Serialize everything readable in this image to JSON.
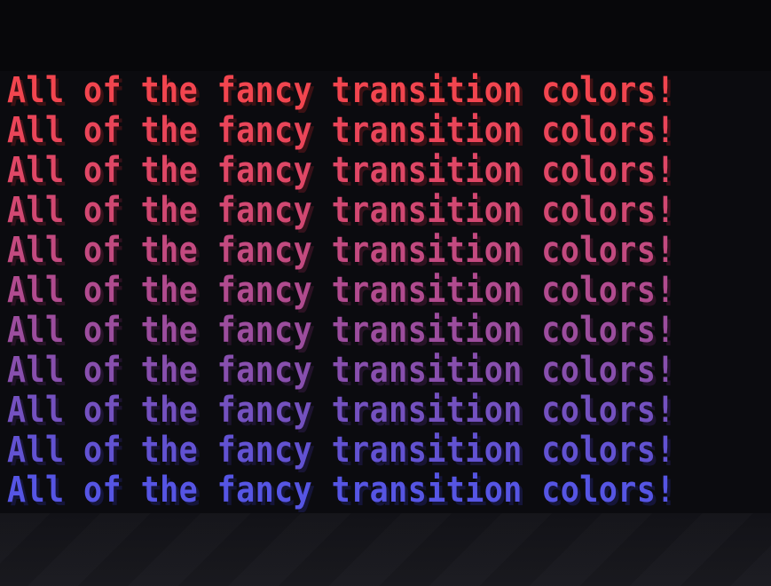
{
  "chat": {
    "lines": [
      {
        "text": "All of the fancy transition colors!",
        "color": "#f2454f",
        "shadow": "#3c1114"
      },
      {
        "text": "All of the fancy transition colors!",
        "color": "#ea4559",
        "shadow": "#3a1116"
      },
      {
        "text": "All of the fancy transition colors!",
        "color": "#e04766",
        "shadow": "#381119"
      },
      {
        "text": "All of the fancy transition colors!",
        "color": "#d24872",
        "shadow": "#34121c"
      },
      {
        "text": "All of the fancy transition colors!",
        "color": "#c34a80",
        "shadow": "#301220"
      },
      {
        "text": "All of the fancy transition colors!",
        "color": "#b14b8f",
        "shadow": "#2c1223"
      },
      {
        "text": "All of the fancy transition colors!",
        "color": "#9c4d9e",
        "shadow": "#271327"
      },
      {
        "text": "All of the fancy transition colors!",
        "color": "#884fae",
        "shadow": "#22132b"
      },
      {
        "text": "All of the fancy transition colors!",
        "color": "#7451c0",
        "shadow": "#1d1430"
      },
      {
        "text": "All of the fancy transition colors!",
        "color": "#6252d2",
        "shadow": "#181434"
      },
      {
        "text": "All of the fancy transition colors!",
        "color": "#5655e4",
        "shadow": "#151539"
      }
    ]
  }
}
